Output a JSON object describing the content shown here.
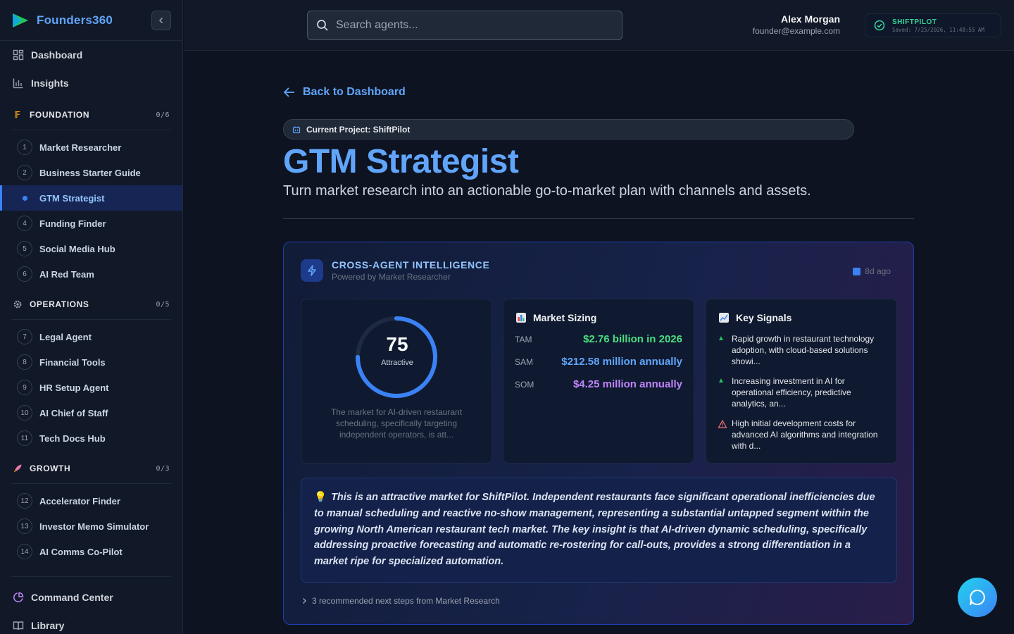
{
  "brand": {
    "name": "Founders360"
  },
  "nav_top": [
    {
      "label": "Dashboard",
      "icon": "grid-icon"
    },
    {
      "label": "Insights",
      "icon": "bar-chart-icon"
    }
  ],
  "sections": [
    {
      "title": "FOUNDATION",
      "count": "0/6",
      "icon": "ladder-icon",
      "items": [
        {
          "num": "1",
          "label": "Market Researcher"
        },
        {
          "num": "2",
          "label": "Business Starter Guide"
        },
        {
          "num": "3",
          "label": "GTM Strategist",
          "active": true
        },
        {
          "num": "4",
          "label": "Funding Finder"
        },
        {
          "num": "5",
          "label": "Social Media Hub"
        },
        {
          "num": "6",
          "label": "AI Red Team"
        }
      ]
    },
    {
      "title": "OPERATIONS",
      "count": "0/5",
      "icon": "gear-icon",
      "items": [
        {
          "num": "7",
          "label": "Legal Agent"
        },
        {
          "num": "8",
          "label": "Financial Tools"
        },
        {
          "num": "9",
          "label": "HR Setup Agent"
        },
        {
          "num": "10",
          "label": "AI Chief of Staff"
        },
        {
          "num": "11",
          "label": "Tech Docs Hub"
        }
      ]
    },
    {
      "title": "GROWTH",
      "count": "0/3",
      "icon": "rocket-icon",
      "items": [
        {
          "num": "12",
          "label": "Accelerator Finder"
        },
        {
          "num": "13",
          "label": "Investor Memo Simulator"
        },
        {
          "num": "14",
          "label": "AI Comms Co-Pilot"
        }
      ]
    }
  ],
  "nav_bottom": [
    {
      "label": "Command Center",
      "icon": "pie-chart-icon"
    },
    {
      "label": "Library",
      "icon": "book-icon"
    }
  ],
  "search": {
    "placeholder": "Search agents..."
  },
  "user": {
    "name": "Alex Morgan",
    "email": "founder@example.com"
  },
  "save_status": {
    "project": "SHIFTPILOT",
    "saved": "Saved: 7/25/2026, 11:48:55 AM"
  },
  "main": {
    "back_label": "Back to Dashboard",
    "project_label": "Current Project: ShiftPilot",
    "title": "GTM Strategist",
    "subtitle": "Turn market research into an actionable go-to-market plan with channels and assets."
  },
  "intel": {
    "title": "CROSS-AGENT INTELLIGENCE",
    "subtitle": "Powered by Market Researcher",
    "ago": "8d ago",
    "score": {
      "value": 75,
      "max": 100,
      "label": "Attractive",
      "description": "The market for AI-driven restaurant scheduling, specifically targeting independent operators, is att..."
    },
    "sizing": {
      "title": "Market Sizing",
      "rows": [
        {
          "key": "TAM",
          "value": "$2.76 billion in 2026",
          "color": "#4ade80"
        },
        {
          "key": "SAM",
          "value": "$212.58 million annually",
          "color": "#60a5fa"
        },
        {
          "key": "SOM",
          "value": "$4.25 million annually",
          "color": "#c084fc"
        }
      ]
    },
    "signals": {
      "title": "Key Signals",
      "items": [
        {
          "type": "up",
          "text": "Rapid growth in restaurant technology adoption, with cloud-based solutions showi..."
        },
        {
          "type": "up",
          "text": "Increasing investment in AI for operational efficiency, predictive analytics, an..."
        },
        {
          "type": "warn",
          "text": "High initial development costs for advanced AI algorithms and integration with d..."
        }
      ]
    },
    "insight": "This is an attractive market for ShiftPilot. Independent restaurants face significant operational inefficiencies due to manual scheduling and reactive no-show management, representing a substantial untapped segment within the growing North American restaurant tech market. The key insight is that AI-driven dynamic scheduling, specifically addressing proactive forecasting and automatic re-rostering for call-outs, provides a strong differentiation in a market ripe for specialized automation.",
    "next_steps": "3 recommended next steps from Market Research"
  },
  "colors": {
    "accent": "#60a5fa",
    "success": "#34d399",
    "warning": "#f87171"
  }
}
